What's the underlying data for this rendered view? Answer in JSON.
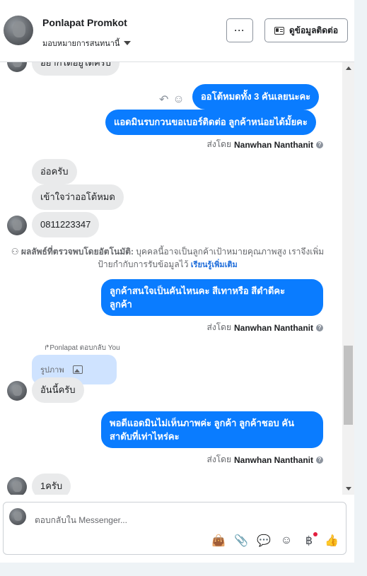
{
  "header": {
    "contact_name": "Ponlapat Promkot",
    "assign_label": "มอบหมายการสนทนานี้",
    "more_label": "···",
    "contact_info_label": "ดูข้อมูลติดต่อ"
  },
  "thread": {
    "partial_top": "อยากได้อยู่ได้ครับ",
    "out1": "ออโต้หมดทั้ง 3 คันเลยนะคะ",
    "out2": "แอดมินรบกวนขอเบอร์ติดต่อ ลูกค้าหน่อยได้มั้ยคะ",
    "sent_by_prefix": "ส่งโดย",
    "sent_by_name": "Nanwhan Nanthanit",
    "in1": "อ่อครับ",
    "in2": "เข้าใจว่าออโต้หมด",
    "in3": "0811223347",
    "detect_title": "ผลลัพธ์ที่ตรวจพบโดยอัตโนมัติ:",
    "detect_body": "บุคคลนี้อาจเป็นลูกค้าเป้าหมายคุณภาพสูง เราจึงเพิ่มป้ายกำกับการรับข้อมูลไว้",
    "detect_link": "เรียนรู้เพิ่มเติม",
    "out3_line1": "ลูกค้าสนใจเป็นคันไหนคะ สีเทาหรือ สีดำดีคะ",
    "out3_line2": "ลูกค้า",
    "reply_label": "Ponlapat ตอบกลับ You",
    "photo_label": "รูปภาพ",
    "in4": "อันนี้ครับ",
    "out4_line1": "พอดีแอดมินไม่เห็นภาพค่ะ ลูกค้า ลูกค้าชอบ คัน",
    "out4_line2": "สาดับที่เท่าไหร่คะ",
    "in5": "1ครับ"
  },
  "composer": {
    "placeholder": "ตอบกลับใน Messenger..."
  },
  "icons": [
    "bag-icon",
    "attach-icon",
    "saved-reply-icon",
    "emoji-icon",
    "baht-icon",
    "like-icon"
  ],
  "colors": {
    "outgoing": "#0a7cff",
    "incoming": "#e9eaeb",
    "link": "#216fdb"
  }
}
